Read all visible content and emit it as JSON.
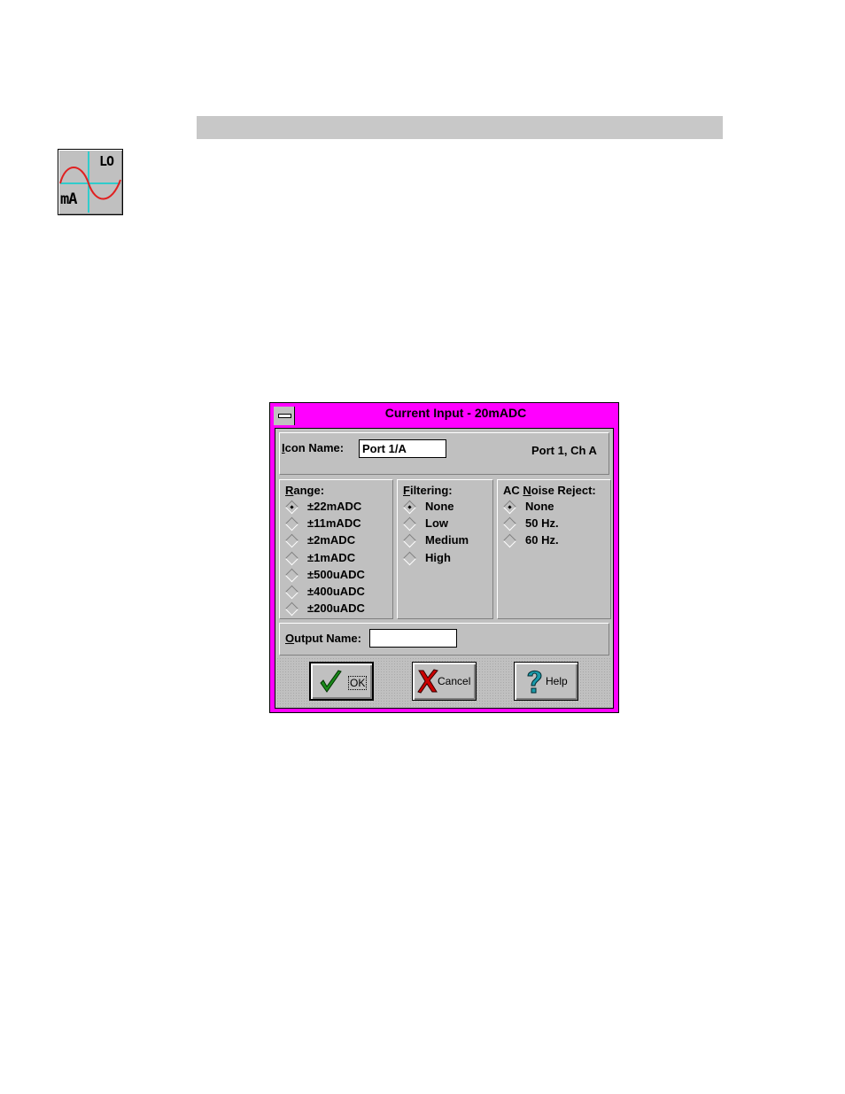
{
  "app_icon": {
    "top_label": "LO",
    "bottom_label": "mA"
  },
  "dialog": {
    "title": "Current Input - 20mADC",
    "icon_name": {
      "label": "Icon Name:",
      "mnemonic": "I",
      "rest": "con Name:",
      "value": "Port 1/A"
    },
    "port_info": "Port 1, Ch A",
    "range": {
      "title_mnemonic": "R",
      "title_rest": "ange:",
      "options": [
        "±22mADC",
        "±11mADC",
        "±2mADC",
        "±1mADC",
        "±500uADC",
        "±400uADC",
        "±200uADC"
      ],
      "selected": "±22mADC"
    },
    "filtering": {
      "title_mnemonic": "F",
      "title_rest": "iltering:",
      "options": [
        "None",
        "Low",
        "Medium",
        "High"
      ],
      "selected": "None"
    },
    "noise_reject": {
      "title_prefix": "AC ",
      "title_mnemonic": "N",
      "title_rest": "oise Reject:",
      "options": [
        "None",
        "50 Hz.",
        "60 Hz."
      ],
      "selected": "None"
    },
    "output_name": {
      "mnemonic": "O",
      "rest": "utput Name:",
      "value": ""
    },
    "buttons": {
      "ok": "OK",
      "cancel": "Cancel",
      "help": "Help"
    }
  },
  "colors": {
    "title_bar": "#ff00ff",
    "face": "#c0c0c0",
    "ok_check": "#1a8a1a",
    "cancel_x": "#cc0000",
    "help_mark": "#1a9aaa",
    "icon_wave": "#e02020",
    "icon_axis": "#00d0d0"
  }
}
